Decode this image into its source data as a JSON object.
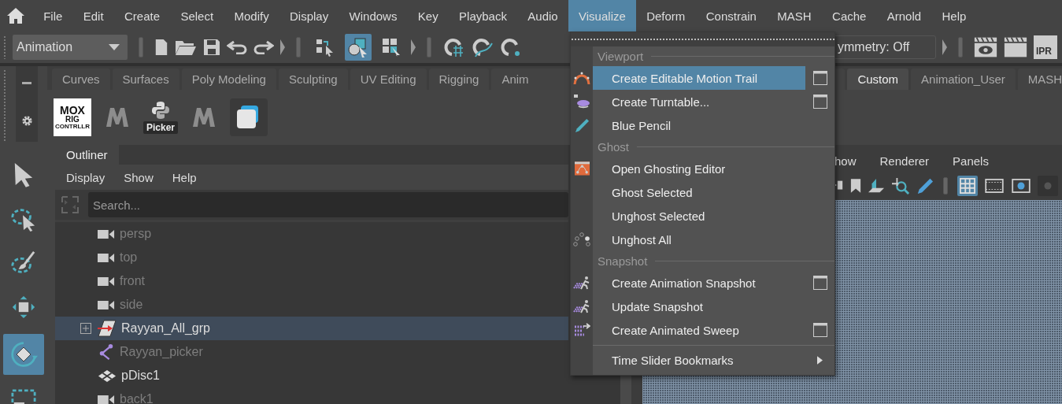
{
  "menubar": [
    {
      "label": "File",
      "selected": false
    },
    {
      "label": "Edit",
      "selected": false
    },
    {
      "label": "Create",
      "selected": false
    },
    {
      "label": "Select",
      "selected": false
    },
    {
      "label": "Modify",
      "selected": false
    },
    {
      "label": "Display",
      "selected": false
    },
    {
      "label": "Windows",
      "selected": false
    },
    {
      "label": "Key",
      "selected": false
    },
    {
      "label": "Playback",
      "selected": false
    },
    {
      "label": "Audio",
      "selected": false
    },
    {
      "label": "Visualize",
      "selected": true
    },
    {
      "label": "Deform",
      "selected": false
    },
    {
      "label": "Constrain",
      "selected": false
    },
    {
      "label": "MASH",
      "selected": false
    },
    {
      "label": "Cache",
      "selected": false
    },
    {
      "label": "Arnold",
      "selected": false
    },
    {
      "label": "Help",
      "selected": false
    }
  ],
  "toolbar": {
    "mode": "Animation",
    "select_modes": [
      {
        "selected": false
      },
      {
        "selected": true
      },
      {
        "selected": false
      }
    ],
    "symmetry": "ymmetry: Off",
    "ipr_label": "IPR"
  },
  "shelf": {
    "tabs": [
      {
        "label": "Curves",
        "selected": false
      },
      {
        "label": "Surfaces",
        "selected": false
      },
      {
        "label": "Poly Modeling",
        "selected": false
      },
      {
        "label": "Sculpting",
        "selected": false
      },
      {
        "label": "UV Editing",
        "selected": false
      },
      {
        "label": "Rigging",
        "selected": false
      },
      {
        "label": "Anim",
        "selected": false
      },
      {
        "label": "Custom",
        "selected": true
      },
      {
        "label": "Animation_User",
        "selected": false
      },
      {
        "label": "MASH",
        "selected": false
      }
    ],
    "items": [
      {
        "kind": "mox",
        "lines": [
          "MOX",
          "RIG",
          "CONTRLLR"
        ]
      },
      {
        "kind": "m_logo"
      },
      {
        "kind": "python",
        "label": "Picker"
      },
      {
        "kind": "m_logo"
      },
      {
        "kind": "app_tile"
      }
    ]
  },
  "tools": [
    {
      "kind": "select",
      "selected": false
    },
    {
      "kind": "lasso",
      "selected": false
    },
    {
      "kind": "paint",
      "selected": false
    },
    {
      "kind": "move",
      "selected": false
    },
    {
      "kind": "rotate",
      "selected": true
    },
    {
      "kind": "scale",
      "selected": false
    }
  ],
  "outliner": {
    "tab": "Outliner",
    "menu": [
      "Display",
      "Show",
      "Help"
    ],
    "search": {
      "placeholder": "Search..."
    },
    "rows": [
      {
        "label": "persp",
        "kind": "camera",
        "dimmed": true,
        "selected": false
      },
      {
        "label": "top",
        "kind": "camera",
        "dimmed": true,
        "selected": false
      },
      {
        "label": "front",
        "kind": "camera",
        "dimmed": true,
        "selected": false
      },
      {
        "label": "side",
        "kind": "camera",
        "dimmed": true,
        "selected": false
      },
      {
        "label": "Rayyan_All_grp",
        "kind": "group",
        "dimmed": false,
        "selected": true,
        "expanded": false
      },
      {
        "label": "Rayyan_picker",
        "kind": "picker",
        "dimmed": true,
        "selected": false
      },
      {
        "label": "pDisc1",
        "kind": "mesh",
        "dimmed": false,
        "selected": false
      },
      {
        "label": "back1",
        "kind": "camera",
        "dimmed": true,
        "selected": false
      }
    ]
  },
  "viewport": {
    "menu": [
      "how",
      "Renderer",
      "Panels"
    ],
    "toggles": [
      {
        "selected": true
      },
      {
        "selected": false
      },
      {
        "selected": false
      },
      {
        "selected": false
      }
    ]
  },
  "visualize_menu": {
    "sections": [
      {
        "title": "Viewport",
        "items": [
          {
            "label": "Create Editable Motion Trail",
            "selected": true,
            "option_box": true
          },
          {
            "label": "Create Turntable...",
            "selected": false,
            "option_box": true
          },
          {
            "label": "Blue Pencil",
            "selected": false,
            "option_box": false
          }
        ]
      },
      {
        "title": "Ghost",
        "items": [
          {
            "label": "Open Ghosting Editor",
            "selected": false,
            "option_box": false
          },
          {
            "label": "Ghost Selected",
            "selected": false,
            "option_box": false
          },
          {
            "label": "Unghost Selected",
            "selected": false,
            "option_box": false
          },
          {
            "label": "Unghost All",
            "selected": false,
            "option_box": false
          }
        ]
      },
      {
        "title": "Snapshot",
        "items": [
          {
            "label": "Create Animation Snapshot",
            "selected": false,
            "option_box": true
          },
          {
            "label": "Update Snapshot",
            "selected": false,
            "option_box": false
          },
          {
            "label": "Create Animated Sweep",
            "selected": false,
            "option_box": true
          }
        ]
      },
      {
        "items": [
          {
            "label": "Time Slider Bookmarks",
            "selected": false,
            "option_box": false,
            "submenu": true
          }
        ]
      }
    ]
  }
}
